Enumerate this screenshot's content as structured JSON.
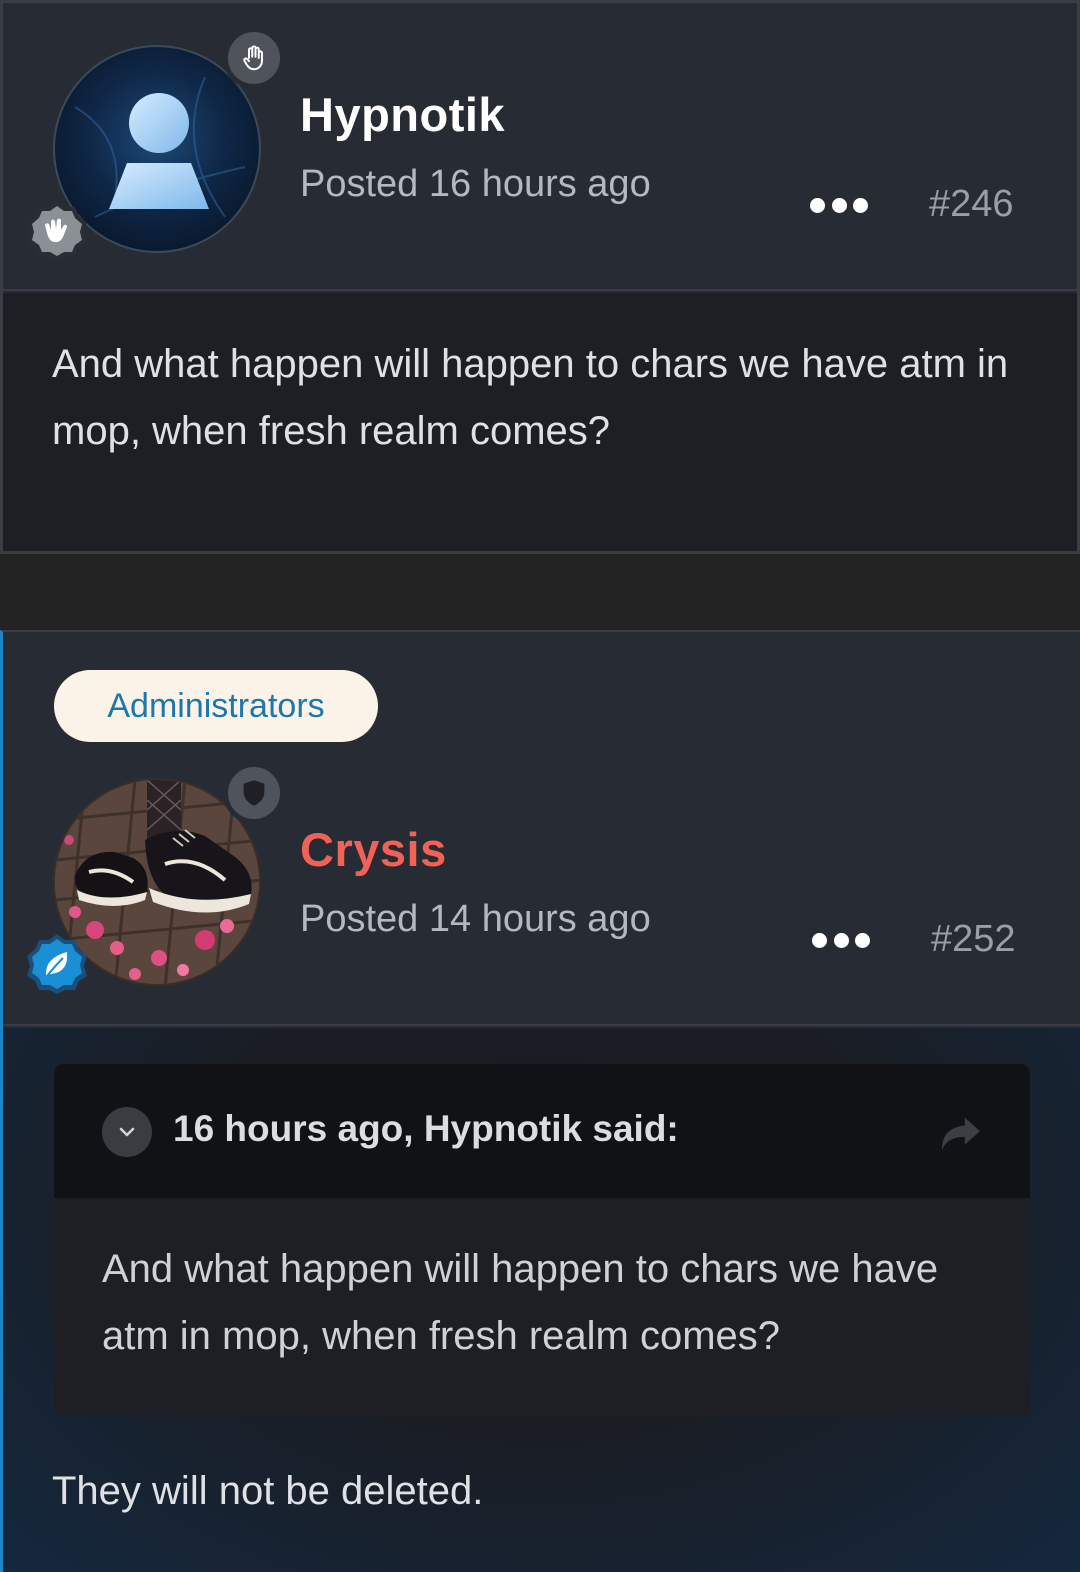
{
  "posts": [
    {
      "author": "Hypnotik",
      "author_color": "#ffffff",
      "posted": "Posted 16 hours ago",
      "number": "#246",
      "avatar_icon": "default-user-avatar-icon",
      "rank_icon": "hand-icon",
      "badge_icon": "wave-hand-icon",
      "body": "And what happen will happen to chars we have atm in mop, when fresh realm comes?"
    },
    {
      "group": "Administrators",
      "author": "Crysis",
      "author_color": "#f06257",
      "posted": "Posted 14 hours ago",
      "number": "#252",
      "avatar_icon": "sneakers-photo-avatar",
      "rank_icon": "shield-icon",
      "badge_icon": "leaf-icon",
      "quote": {
        "citation": "16 hours ago, Hypnotik said:",
        "text": "And what happen will happen to chars we have atm in mop, when fresh realm comes?"
      },
      "body": "They will not be deleted."
    }
  ],
  "colors": {
    "accent_blue": "#1d86c8",
    "admin_name": "#f06257",
    "pill_bg": "#fbf3e7",
    "pill_text": "#1c77ad"
  }
}
